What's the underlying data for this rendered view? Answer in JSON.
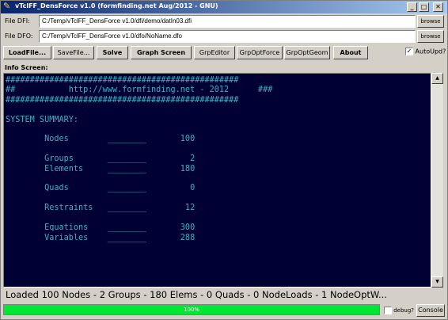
{
  "window": {
    "title": "vTclFF_DensForce v1.0 (formfinding.net Aug/2012 - GNU)",
    "icon": "feather-icon",
    "controls": {
      "minimize": "_",
      "maximize": "□",
      "close": "✕"
    }
  },
  "files": {
    "dfi_label": "File DFI:",
    "dfi_value": "C:/Temp/vTclFF_DensForce v1.0/dfi/demo/datIn03.dfi",
    "dfo_label": "File DFO:",
    "dfo_value": "C:/Temp/vTclFF_DensForce v1.0/dfo/NoName.dfo",
    "browse_label": "browse"
  },
  "toolbar": {
    "load": "LoadFile...",
    "save": "SaveFile...",
    "solve": "Solve",
    "graph": "Graph Screen",
    "grp_editor": "GrpEditor",
    "grp_opt_force": "GrpOptForce",
    "grp_opt_geom": "GrpOptGeom",
    "about": "About",
    "autoupd_label": "AutoUpd?",
    "autoupd_checked": true
  },
  "info": {
    "label": "Info Screen:",
    "console_text": "################################################\n##           http://www.formfinding.net - 2012      ###\n################################################\n\nSYSTEM SUMMARY:\n\n        Nodes        ________       100\n\n        Groups       ________         2\n        Elements     ________       180\n\n        Quads        ________         0\n\n        Restraints   ________        12\n\n        Equations    ________       300\n        Variables    ________       288"
  },
  "status": {
    "line": "Loaded 100 Nodes - 2 Groups - 180 Elems - 0 Quads - 0 NodeLoads - 1 NodeOptW...",
    "progress_percent": 100,
    "progress_label": "100%",
    "debug_label": "debug?",
    "debug_checked": false,
    "console_button": "Console"
  },
  "colors": {
    "console_bg": "#000034",
    "console_fg": "#3ab3c4",
    "progress_fill": "#00e633",
    "titlebar_start": "#0a246a"
  }
}
